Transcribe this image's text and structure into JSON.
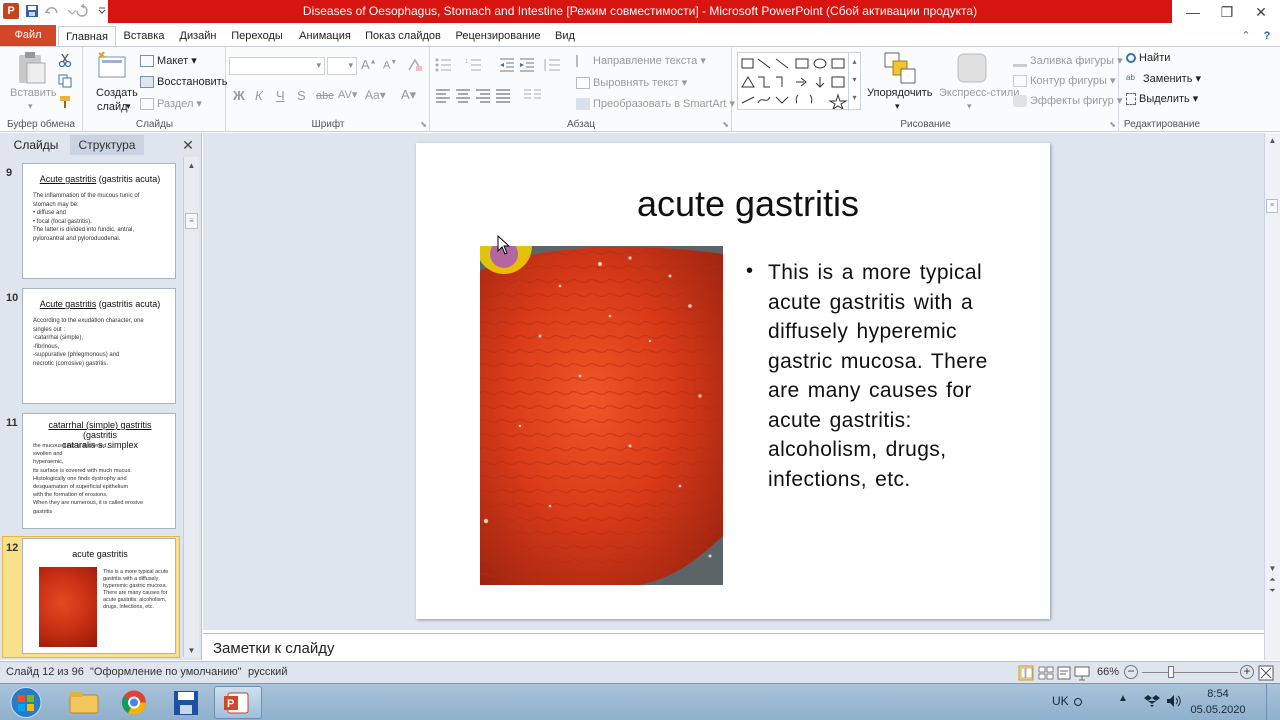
{
  "window": {
    "title": "Diseases of Oesophagus, Stomach and Intestine [Режим совместимости] - Microsoft PowerPoint (Сбой активации продукта)",
    "title_bar_color": "#d7140f"
  },
  "tabs": [
    "Файл",
    "Главная",
    "Вставка",
    "Дизайн",
    "Переходы",
    "Анимация",
    "Показ слайдов",
    "Рецензирование",
    "Вид"
  ],
  "ribbon": {
    "clipboard": {
      "paste": "Вставить",
      "label": "Буфер обмена"
    },
    "slides": {
      "new_slide": "Создать",
      "new_slide2": "слайд",
      "layout": "Макет",
      "reset": "Восстановить",
      "section": "Раздел",
      "label": "Слайды"
    },
    "font": {
      "bold": "Ж",
      "italic": "К",
      "underline": "Ч",
      "strike": "S",
      "shadow": "abc",
      "spacing": "AV",
      "case": "Aa",
      "color": "A",
      "grow": "A",
      "shrink": "A",
      "label": "Шрифт"
    },
    "paragraph": {
      "text_direction": "Направление текста",
      "align_text": "Выровнять текст",
      "smartart": "Преобразовать в SmartArt",
      "label": "Абзац"
    },
    "drawing": {
      "arrange": "Упорядочить",
      "quick_styles": "Экспресс-стили",
      "shape_fill": "Заливка фигуры",
      "shape_outline": "Контур фигуры",
      "shape_effects": "Эффекты фигур",
      "label": "Рисование"
    },
    "editing": {
      "find": "Найти",
      "replace": "Заменить",
      "select": "Выделить",
      "label": "Редактирование"
    }
  },
  "left_pane": {
    "tab_slides": "Слайды",
    "tab_outline": "Структура",
    "thumbnails": [
      {
        "num": "9",
        "title_u": "Acute gastritis",
        "title_rest": " (gastritis acuta)",
        "body": "The inflammation of the mucous tunic of\n   stomach may be:\n•  diffuse and\n•  focal (focal gastritis).\nThe latter is divided into fundic, antral,\n   pyloroantral and pyloroduodenal."
      },
      {
        "num": "10",
        "title_u": "Acute gastritis",
        "title_rest": " (gastritis acuta)",
        "body": "According to the exudation character, one\n   singles out :\n-catarrhal (simple),\n-fibrinous,\n-suppurative (phlegmonous) and\nnecrotic (corrosive) gastritis."
      },
      {
        "num": "11",
        "title_u": "catarrhal (simple) gastritis",
        "title_rest": " (gastritis\ncataralis s. simplex",
        "body": "the mucous tunic is thickened,\nswollen and\nhyperaemic,\nits surface is covered with much mucus.\n   Histologically one finds dystrophy and\n   desquamation of superficial epithelium\n   with the formation of erosions.\nWhen they are numerous, it is called erosive\n   gastritis"
      },
      {
        "num": "12",
        "title_u": "",
        "title_rest": "acute gastritis",
        "body": "This is a more typical acute gastritis with a diffusely hyperemic gastric mucosa. There are many causes for acute gastritis: alcoholism, drugs, infections, etc."
      }
    ]
  },
  "slide": {
    "title": "acute gastritis",
    "bullet": "This is a more typical acute gastritis with a diffusely hyperemic gastric mucosa. There are many causes for acute gastritis: alcoholism, drugs, infections, etc."
  },
  "notes_placeholder": "Заметки к слайду",
  "status": {
    "slide_counter": "Слайд 12 из 96",
    "theme": "\"Оформление по умолчанию\"",
    "language": "русский",
    "zoom": "66%"
  },
  "taskbar": {
    "lang": "UK",
    "time": "8:54",
    "date": "05.05.2020"
  }
}
